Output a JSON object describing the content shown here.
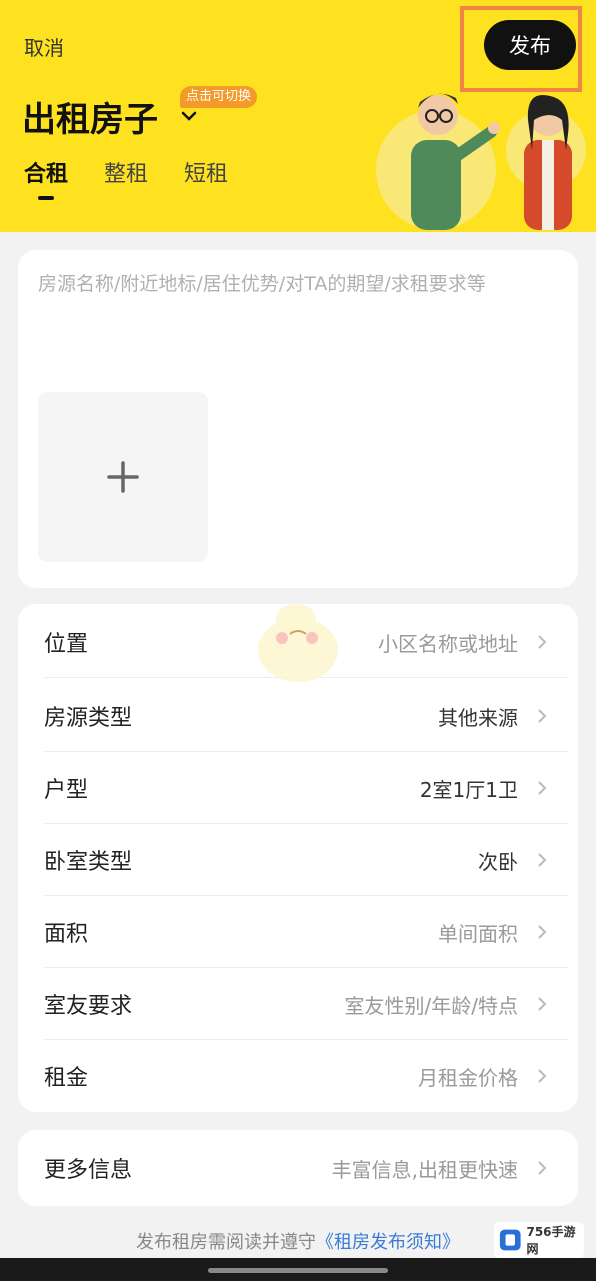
{
  "header": {
    "cancel_label": "取消",
    "publish_label": "发布",
    "title": "出租房子",
    "switch_badge": "点击可切换",
    "tabs": [
      {
        "label": "合租",
        "active": true
      },
      {
        "label": "整租",
        "active": false
      },
      {
        "label": "短租",
        "active": false
      }
    ],
    "accent_color": "#ffe21f",
    "highlight_color": "#f18447"
  },
  "description": {
    "placeholder": "房源名称/附近地标/居住优势/对TA的期望/求租要求等",
    "add_photo_icon": "plus-icon"
  },
  "info_rows": [
    {
      "label": "位置",
      "value": "小区名称或地址",
      "filled": false
    },
    {
      "label": "房源类型",
      "value": "其他来源",
      "filled": true
    },
    {
      "label": "户型",
      "value": "2室1厅1卫",
      "filled": true
    },
    {
      "label": "卧室类型",
      "value": "次卧",
      "filled": true
    },
    {
      "label": "面积",
      "value": "单间面积",
      "filled": false
    },
    {
      "label": "室友要求",
      "value": "室友性别/年龄/特点",
      "filled": false
    },
    {
      "label": "租金",
      "value": "月租金价格",
      "filled": false
    }
  ],
  "more_info": {
    "label": "更多信息",
    "value": "丰富信息,出租更快速"
  },
  "footer": {
    "prefix": "发布租房需阅读并遵守",
    "link": "《租房发布须知》"
  },
  "watermark": {
    "text": "756手游网"
  }
}
